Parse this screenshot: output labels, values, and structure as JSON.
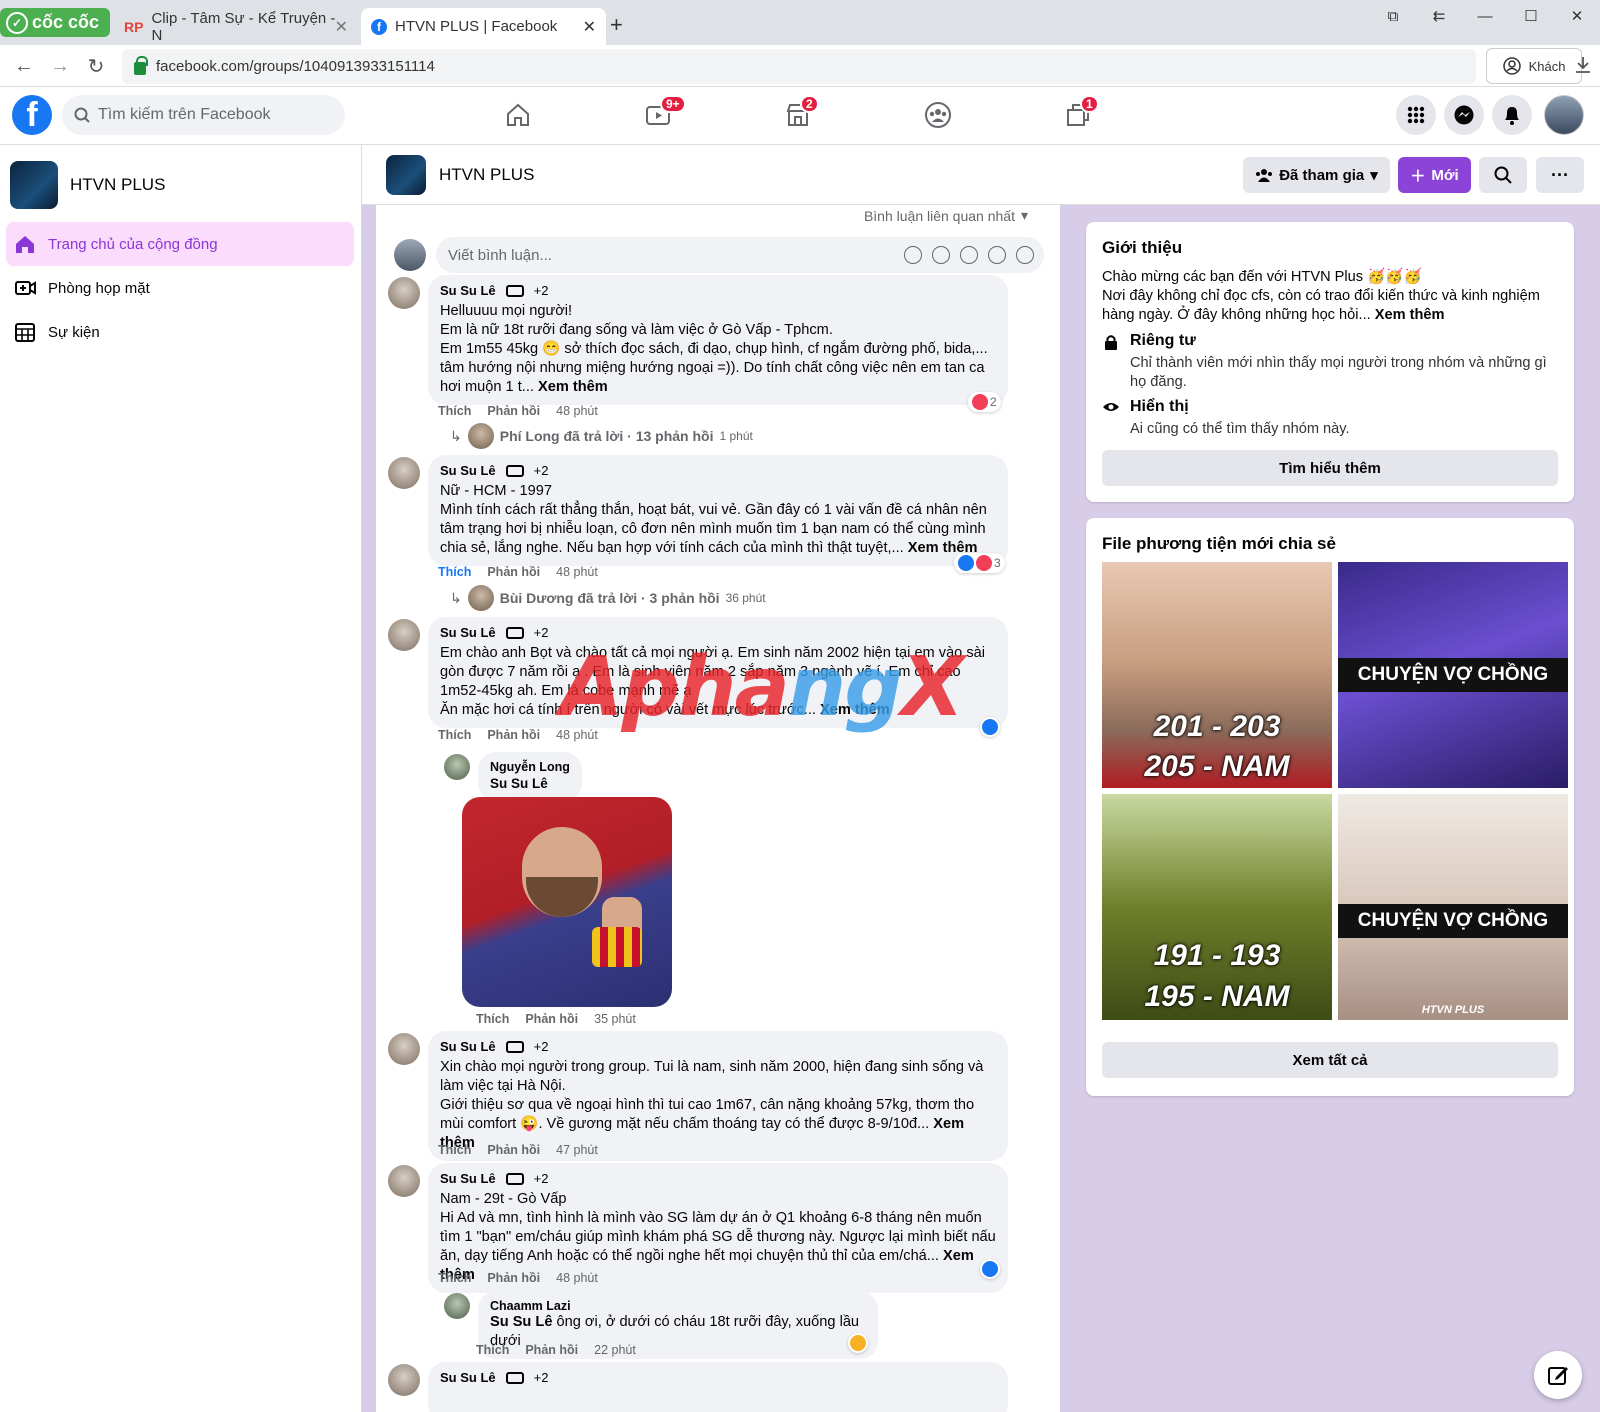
{
  "browser": {
    "brand": "cốc cốc",
    "tabs": [
      {
        "label": "Clip - Tâm Sự - Kể Truyện - N",
        "icon": "RP"
      },
      {
        "label": "HTVN PLUS | Facebook",
        "icon": "f"
      }
    ],
    "url": "facebook.com/groups/1040913933151114",
    "guest_label": "Khách"
  },
  "fb": {
    "search_placeholder": "Tìm kiếm trên Facebook",
    "badges": {
      "watch": "9+",
      "marketplace": "2",
      "gaming": "1"
    }
  },
  "sidebar": {
    "group_name": "HTVN PLUS",
    "items": [
      {
        "label": "Trang chủ của cộng đồng",
        "icon": "home-icon"
      },
      {
        "label": "Phòng họp mặt",
        "icon": "video-room-icon"
      },
      {
        "label": "Sự kiện",
        "icon": "calendar-icon"
      }
    ]
  },
  "group_header": {
    "name": "HTVN PLUS",
    "joined_label": "Đã tham gia",
    "new_label": "Mới"
  },
  "feed": {
    "sort_label": "Bình luận liên quan nhất",
    "comment_placeholder": "Viết bình luận...",
    "like": "Thích",
    "reply": "Phản hồi",
    "see_more": "Xem thêm",
    "comments": [
      {
        "author": "Su Su Lê",
        "extra": "+2",
        "text": "Helluuuu mọi người!\nEm là nữ 18t rưỡi đang sống và làm việc ở Gò Vấp - Tphcm.\nEm 1m55 45kg 😁 sở thích đọc sách, đi dạo, chụp hình, cf ngắm đường phố, bida,... tâm hướng nội nhưng miệng hướng ngoại =)). Do tính chất công việc nên em tan ca hơi muộn 1 t...",
        "time": "48 phút",
        "reactions": "2",
        "reply_summary": {
          "text": "Phí Long đã trả lời · 13 phản hồi",
          "time": "1 phút"
        }
      },
      {
        "author": "Su Su Lê",
        "extra": "+2",
        "text": "Nữ - HCM - 1997\nMình tính cách rất thẳng thắn, hoạt bát, vui vẻ. Gần đây có 1 vài vấn đề cá nhân nên tâm trạng hơi bị nhiễu loạn, cô đơn nên mình muốn tìm 1 bạn nam có thể cùng mình chia sẻ, lắng nghe. Nếu bạn hợp với tính cách của mình thì thật tuyệt,...",
        "time": "48 phút",
        "reactions": "3",
        "reply_summary": {
          "text": "Bùi Dương đã trả lời · 3 phản hồi",
          "time": "36 phút"
        }
      },
      {
        "author": "Su Su Lê",
        "extra": "+2",
        "text": "Em chào anh Bọt và chào tất cả mọi người ạ. Em sinh năm 2002 hiện tại em vào sài gòn được 7 năm rồi ạ . Em là sinh viên năm 2 sắp năm 3 ngành vẽ í. Em chỉ cao 1m52-45kg ah. Em là cobe mạnh mẽ ạ\nĂn mặc hơi cá tính í trên người có vài vết mực lúc trước...",
        "time": "48 phút",
        "reply": {
          "author": "Nguyễn Long",
          "text": "Su Su Lê",
          "time": "35 phút"
        }
      },
      {
        "author": "Su Su Lê",
        "extra": "+2",
        "text": "Xin chào mọi người trong group. Tui là nam, sinh năm 2000, hiện đang sinh sống và làm việc tại Hà Nội.\nGiới thiệu sơ qua về ngoại hình thì tui cao 1m67, cân nặng khoảng 57kg, thơm tho mùi comfort 😜. Về gương mặt nếu chấm thoáng tay có thể được 8-9/10đ...",
        "time": "47 phút"
      },
      {
        "author": "Su Su Lê",
        "extra": "+2",
        "text": "Nam - 29t - Gò Vấp\nHi Ad và mn, tình hình là mình vào SG làm dự án ở Q1 khoảng 6-8 tháng nên muốn tìm 1 \"bạn\" em/cháu giúp mình khám phá SG dễ thương này. Ngược lại mình biết nấu ăn, dạy tiếng Anh hoặc có thể ngồi nghe hết mọi chuyện thủ thỉ của em/chá...",
        "time": "48 phút",
        "reply": {
          "author": "Chaamm Lazi",
          "mention": "Su Su Lê",
          "text": " ông ơi, ở dưới có cháu 18t rưỡi đây, xuống lầu dưới",
          "time": "22 phút"
        }
      },
      {
        "author": "Su Su Lê",
        "extra": "+2"
      }
    ]
  },
  "about": {
    "title": "Giới thiệu",
    "desc": "Chào mừng các bạn đến với HTVN Plus 🥳🥳🥳\nNơi đây không chỉ đọc cfs, còn có trao đổi kiến thức và kinh nghiệm hàng ngày. Ở đây không những học hỏi...",
    "see_more": "Xem thêm",
    "private_title": "Riêng tư",
    "private_desc": "Chỉ thành viên mới nhìn thấy mọi người trong nhóm và những gì họ đăng.",
    "visible_title": "Hiển thị",
    "visible_desc": "Ai cũng có thể tìm thấy nhóm này.",
    "learn_more": "Tìm hiểu thêm"
  },
  "media": {
    "title": "File phương tiện mới chia sẻ",
    "items": [
      {
        "line1": "201 - 203",
        "line2": "205 - NAM"
      },
      {
        "banner": "CHUYỆN VỢ CHỒNG"
      },
      {
        "line1": "191 - 193",
        "line2": "195 - NAM"
      },
      {
        "banner": "CHUYỆN VỢ CHỒNG",
        "footer": "HTVN PLUS"
      }
    ],
    "see_all": "Xem tất cả"
  },
  "watermark": {
    "part1": "Apha",
    "part2": "ng",
    "part3": "X"
  },
  "colors": {
    "accent": "#8c43d8",
    "fb_blue": "#1877f2",
    "page_bg": "#d8cde8"
  }
}
